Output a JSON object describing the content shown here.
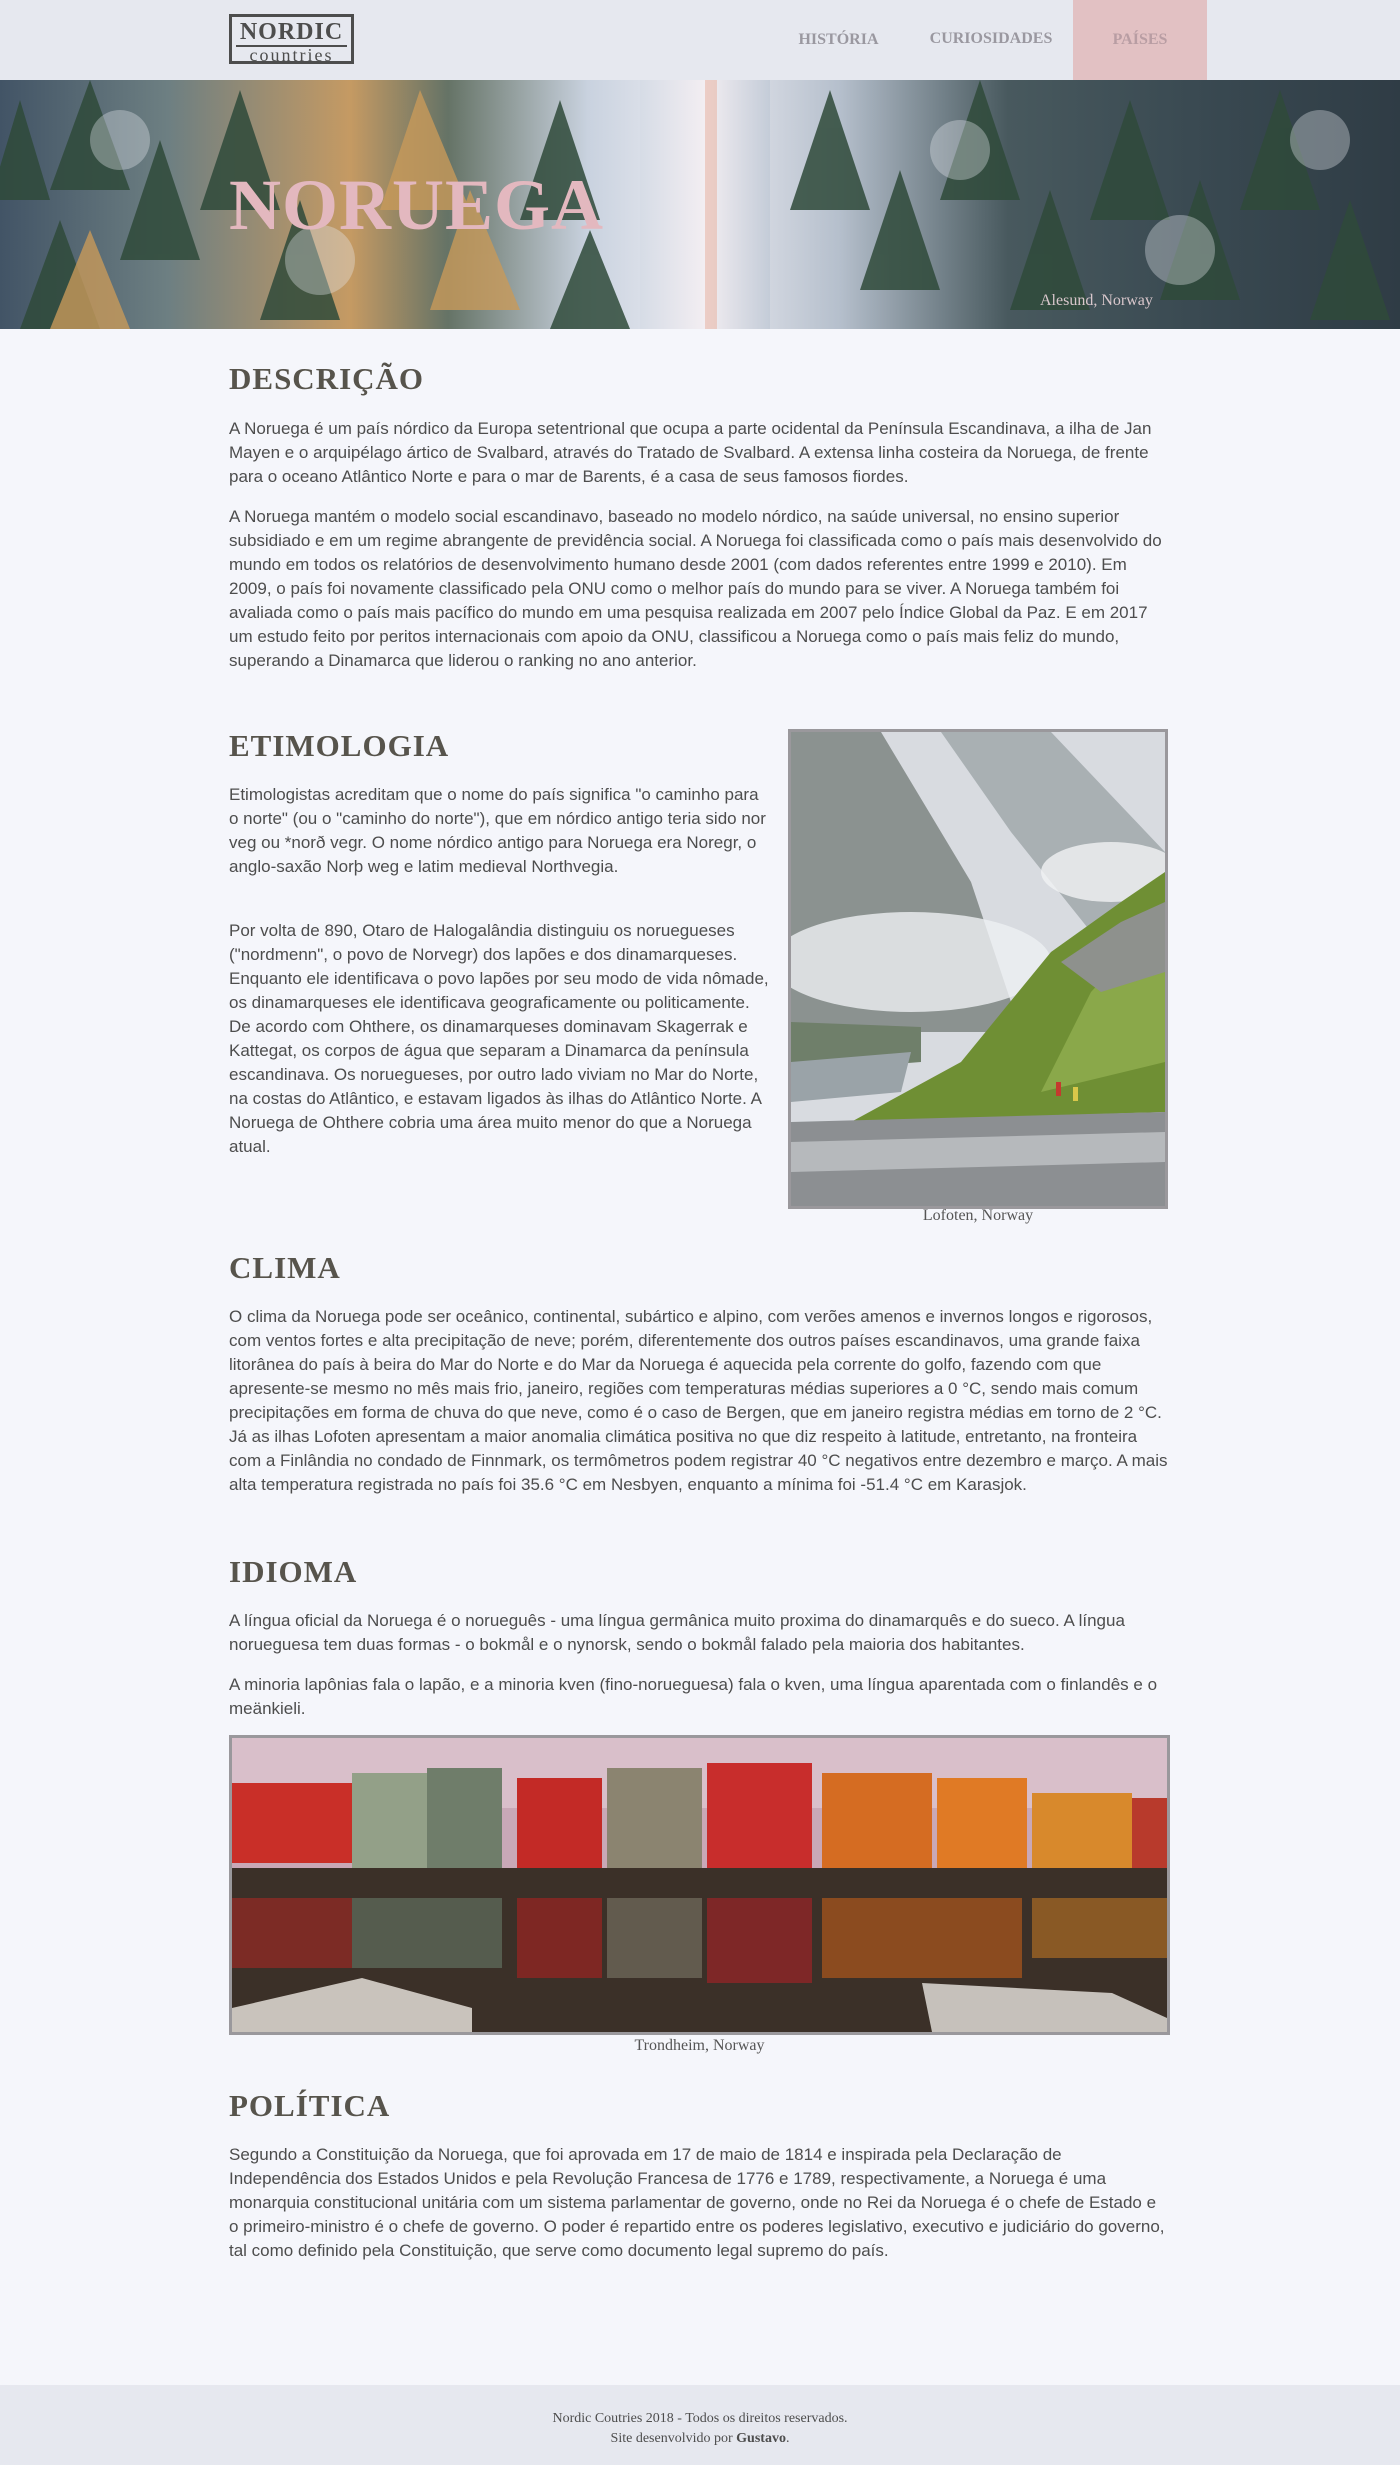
{
  "header": {
    "logo_top": "NORDIC",
    "logo_bottom": "countries",
    "nav": [
      {
        "label": "HISTÓRIA"
      },
      {
        "label": "CURIOSIDADES"
      },
      {
        "label": "PAÍSES"
      }
    ],
    "active_nav": "PAÍSES"
  },
  "hero": {
    "title": "NORUEGA",
    "caption": "Alesund, Norway"
  },
  "sections": {
    "descricao": {
      "title": "DESCRIÇÃO",
      "p1": "A Noruega é um país nórdico da Europa setentrional que ocupa a parte ocidental da Península Escandinava, a ilha de Jan Mayen e o arquipélago ártico de Svalbard, através do Tratado de Svalbard. A extensa linha costeira da Noruega, de frente para o oceano Atlântico Norte e para o mar de Barents, é a casa de seus famosos fiordes.",
      "p2": "A Noruega mantém o modelo social escandinavo, baseado no modelo nórdico, na saúde universal, no ensino superior subsidiado e em um regime abrangente de previdência social. A Noruega foi classificada como o país mais desenvolvido do mundo em todos os relatórios de desenvolvimento humano desde 2001 (com dados referentes entre 1999 e 2010). Em 2009, o país foi novamente classificado pela ONU como o melhor país do mundo para se viver. A Noruega também foi avaliada como o país mais pacífico do mundo em uma pesquisa realizada em 2007 pelo Índice Global da Paz. E em 2017 um estudo feito por peritos internacionais com apoio da ONU, classificou a Noruega como o país mais feliz do mundo, superando a Dinamarca que liderou o ranking no ano anterior."
    },
    "etimologia": {
      "title": "ETIMOLOGIA",
      "p1": "Etimologistas acreditam que o nome do país significa \"o caminho para o norte\" (ou o \"caminho do norte\"), que em nórdico antigo teria sido nor veg ou *norð vegr. O nome nórdico antigo para Noruega era Noregr, o anglo-saxão Norþ weg e latim medieval Northvegia.",
      "p2": "Por volta de 890, Otaro de Halogalândia distinguiu os noruegueses (\"nordmenn\", o povo de Norvegr) dos lapões e dos dinamarqueses. Enquanto ele identificava o povo lapões por seu modo de vida nômade, os dinamarqueses ele identificava geograficamente ou politicamente. De acordo com Ohthere, os dinamarqueses dominavam Skagerrak e Kattegat, os corpos de água que separam a Dinamarca da península escandinava. Os noruegueses, por outro lado viviam no Mar do Norte, na costas do Atlântico, e estavam ligados às ilhas do Atlântico Norte. A Noruega de Ohthere cobria uma área muito menor do que a Noruega atual.",
      "photo_caption": "Lofoten, Norway"
    },
    "clima": {
      "title": "CLIMA",
      "p1": "O clima da Noruega pode ser oceânico, continental, subártico e alpino, com verões amenos e invernos longos e rigorosos, com ventos fortes e alta precipitação de neve; porém, diferentemente dos outros países escandinavos, uma grande faixa litorânea do país à beira do Mar do Norte e do Mar da Noruega é aquecida pela corrente do golfo, fazendo com que apresente-se mesmo no mês mais frio, janeiro, regiões com temperaturas médias superiores a 0 °C, sendo mais comum precipitações em forma de chuva do que neve, como é o caso de Bergen, que em janeiro registra médias em torno de 2 °C. Já as ilhas Lofoten apresentam a maior anomalia climática positiva no que diz respeito à latitude, entretanto, na fronteira com a Finlândia no condado de Finnmark, os termômetros podem registrar 40 °C negativos entre dezembro e março. A mais alta temperatura registrada no país foi 35.6 °C em Nesbyen, enquanto a mínima foi -51.4 °C em Karasjok."
    },
    "idioma": {
      "title": "IDIOMA",
      "p1": "A língua oficial da Noruega é o norueguês - uma língua germânica muito proxima do dinamarquês e do sueco. A língua norueguesa tem duas formas - o bokmål e o nynorsk, sendo o bokmål falado pela maioria dos habitantes.",
      "p2": "A minoria lapônias fala o lapão, e a minoria kven (fino-norueguesa) fala o kven, uma língua aparentada com o finlandês e o meänkieli.",
      "photo_caption": "Trondheim, Norway"
    },
    "politica": {
      "title": "POLÍTICA",
      "p1": "Segundo a Constituição da Noruega, que foi aprovada em 17 de maio de 1814 e inspirada pela Declaração de Independência dos Estados Unidos e pela Revolução Francesa de 1776 e 1789, respectivamente, a Noruega é uma monarquia constitucional unitária com um sistema parlamentar de governo, onde no Rei da Noruega é o chefe de Estado e o primeiro-ministro é o chefe de governo. O poder é repartido entre os poderes legislativo, executivo e judiciário do governo, tal como definido pela Constituição, que serve como documento legal supremo do país."
    }
  },
  "footer": {
    "line1": "Nordic Coutries 2018 - Todos os direitos reservados.",
    "line2_prefix": "Site desenvolvido por ",
    "line2_author": "Gustavo",
    "line2_suffix": "."
  },
  "colors": {
    "background": "#f5f6fb",
    "header_bg": "#e6e8ef",
    "active_nav_bg": "#e2c1c3",
    "hero_title": "#e3b8bf",
    "heading": "#57544c",
    "text": "#4d4d4d"
  }
}
